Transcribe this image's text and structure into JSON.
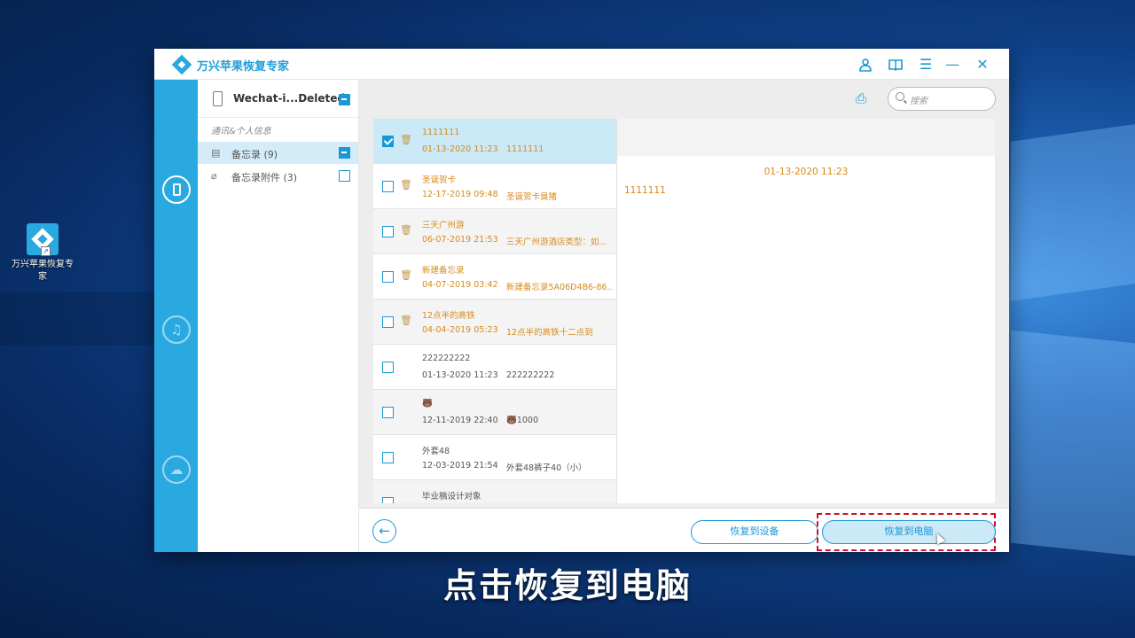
{
  "desktop": {
    "icon_label": "万兴苹果恢复专家"
  },
  "app": {
    "title": "万兴苹果恢复专家",
    "accent_color": "#29a9df",
    "deleted_text_color": "#d88a1c"
  },
  "titlebar_icons": [
    "user-icon",
    "book-icon",
    "menu-icon",
    "minimize-icon",
    "close-icon"
  ],
  "rail": {
    "items": [
      "device-recover-icon",
      "itunes-recover-icon",
      "icloud-recover-icon"
    ]
  },
  "category_panel": {
    "device_name": "Wechat-i...Deleted",
    "section_label": "通讯&个人信息",
    "items": [
      {
        "label": "备忘录 (9)",
        "icon": "note-icon",
        "state": "partial"
      },
      {
        "label": "备忘录附件 (3)",
        "icon": "attachment-icon",
        "state": "unchecked"
      }
    ]
  },
  "search": {
    "placeholder": "搜索"
  },
  "notes": [
    {
      "title": "1111111",
      "date": "01-13-2020 11:23",
      "preview": "1111111",
      "deleted": true,
      "checked": true
    },
    {
      "title": "圣诞贺卡",
      "date": "12-17-2019 09:48",
      "preview": "圣诞贺卡臭猪",
      "deleted": true,
      "checked": false
    },
    {
      "title": "三天广州游",
      "date": "06-07-2019 21:53",
      "preview": "三天广州游酒店类型：如...",
      "deleted": true,
      "checked": false
    },
    {
      "title": "新建备忘录",
      "date": "04-07-2019 03:42",
      "preview": "新建备忘录5A06D4B6-86...",
      "deleted": true,
      "checked": false
    },
    {
      "title": "12点半的高铁",
      "date": "04-04-2019 05:23",
      "preview": "12点半的高铁十二点到",
      "deleted": true,
      "checked": false
    },
    {
      "title": "222222222",
      "date": "01-13-2020 11:23",
      "preview": "222222222",
      "deleted": false,
      "checked": false
    },
    {
      "title": "🐻",
      "date": "12-11-2019 22:40",
      "preview": "🐻1000",
      "deleted": false,
      "checked": false
    },
    {
      "title": "外套48",
      "date": "12-03-2019 21:54",
      "preview": "外套48裤子40（小）",
      "deleted": false,
      "checked": false
    },
    {
      "title": "毕业稿设计对象",
      "date": "",
      "preview": "",
      "deleted": false,
      "checked": false
    }
  ],
  "detail": {
    "date": "01-13-2020 11:23",
    "body": "1111111"
  },
  "footer": {
    "recover_to_device": "恢复到设备",
    "recover_to_computer": "恢复到电脑"
  },
  "subtitle": "点击恢复到电脑"
}
